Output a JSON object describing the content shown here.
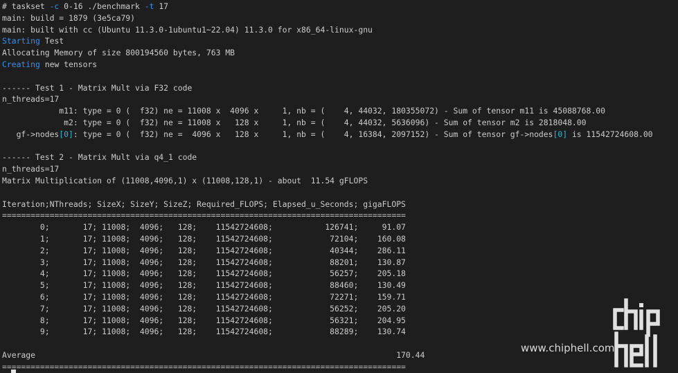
{
  "terminal": {
    "lines": [
      {
        "parts": [
          {
            "t": "# taskset "
          },
          {
            "t": "-c",
            "c": "blue"
          },
          {
            "t": " 0-16 ./benchmark "
          },
          {
            "t": "-t",
            "c": "blue"
          },
          {
            "t": " 17"
          }
        ]
      },
      {
        "parts": [
          {
            "t": "main: build = 1879 (3e5ca79)"
          }
        ]
      },
      {
        "parts": [
          {
            "t": "main: built with cc (Ubuntu 11.3.0-1ubuntu1~22.04) 11.3.0 for x86_64-linux-gnu"
          }
        ]
      },
      {
        "parts": [
          {
            "t": "Starting",
            "c": "blue"
          },
          {
            "t": " Test"
          }
        ]
      },
      {
        "parts": [
          {
            "t": "Allocating Memory of size 800194560 bytes, 763 MB"
          }
        ]
      },
      {
        "parts": [
          {
            "t": "Creating",
            "c": "blue"
          },
          {
            "t": " new tensors"
          }
        ]
      },
      {
        "parts": [
          {
            "t": ""
          }
        ]
      },
      {
        "parts": [
          {
            "t": "------ Test 1 - Matrix Mult via F32 code"
          }
        ]
      },
      {
        "parts": [
          {
            "t": "n_threads=17"
          }
        ]
      },
      {
        "parts": [
          {
            "t": "            m11: type = 0 (  f32) ne = 11008 x  4096 x     1, nb = (    4, 44032, 180355072) - Sum of tensor m11 is 45088768.00"
          }
        ]
      },
      {
        "parts": [
          {
            "t": "             m2: type = 0 (  f32) ne = 11008 x   128 x     1, nb = (    4, 44032, 5636096) - Sum of tensor m2 is 2818048.00"
          }
        ]
      },
      {
        "parts": [
          {
            "t": "   gf->nodes"
          },
          {
            "t": "[0]",
            "c": "cyan"
          },
          {
            "t": ": type = 0 (  f32) ne =  4096 x   128 x     1, nb = (    4, 16384, 2097152) - Sum of tensor gf->nodes"
          },
          {
            "t": "[0]",
            "c": "cyan"
          },
          {
            "t": " is 11542724608.00"
          }
        ]
      },
      {
        "parts": [
          {
            "t": ""
          }
        ]
      },
      {
        "parts": [
          {
            "t": "------ Test 2 - Matrix Mult via q4_1 code"
          }
        ]
      },
      {
        "parts": [
          {
            "t": "n_threads=17"
          }
        ]
      },
      {
        "parts": [
          {
            "t": "Matrix Multiplication of (11008,4096,1) x (11008,128,1) - about  11.54 gFLOPS"
          }
        ]
      },
      {
        "parts": [
          {
            "t": ""
          }
        ]
      },
      {
        "parts": [
          {
            "t": "Iteration;NThreads; SizeX; SizeY; SizeZ; Required_FLOPS; Elapsed_u_Seconds; gigaFLOPS"
          }
        ]
      },
      {
        "parts": [
          {
            "t": "=====================================================================================",
            "c": "sep"
          }
        ]
      },
      {
        "parts": [
          {
            "t": "        0;       17; 11008;  4096;   128;    11542724608;           126741;     91.07"
          }
        ]
      },
      {
        "parts": [
          {
            "t": "        1;       17; 11008;  4096;   128;    11542724608;            72104;    160.08"
          }
        ]
      },
      {
        "parts": [
          {
            "t": "        2;       17; 11008;  4096;   128;    11542724608;            40344;    286.11"
          }
        ]
      },
      {
        "parts": [
          {
            "t": "        3;       17; 11008;  4096;   128;    11542724608;            88201;    130.87"
          }
        ]
      },
      {
        "parts": [
          {
            "t": "        4;       17; 11008;  4096;   128;    11542724608;            56257;    205.18"
          }
        ]
      },
      {
        "parts": [
          {
            "t": "        5;       17; 11008;  4096;   128;    11542724608;            88460;    130.49"
          }
        ]
      },
      {
        "parts": [
          {
            "t": "        6;       17; 11008;  4096;   128;    11542724608;            72271;    159.71"
          }
        ]
      },
      {
        "parts": [
          {
            "t": "        7;       17; 11008;  4096;   128;    11542724608;            56252;    205.20"
          }
        ]
      },
      {
        "parts": [
          {
            "t": "        8;       17; 11008;  4096;   128;    11542724608;            56321;    204.95"
          }
        ]
      },
      {
        "parts": [
          {
            "t": "        9;       17; 11008;  4096;   128;    11542724608;            88289;    130.74"
          }
        ]
      },
      {
        "parts": [
          {
            "t": ""
          }
        ]
      },
      {
        "parts": [
          {
            "t": "Average                                                                            170.44"
          }
        ]
      },
      {
        "parts": [
          {
            "t": "=====================================================================================",
            "c": "sep"
          }
        ]
      }
    ]
  },
  "watermark": {
    "site_text": "www.chiphell.com",
    "logo_text": "chip hell"
  },
  "colors": {
    "background": "#1e1e1e",
    "text": "#cccccc",
    "keyword_blue": "#3b8eea",
    "index_cyan": "#29b8db"
  }
}
